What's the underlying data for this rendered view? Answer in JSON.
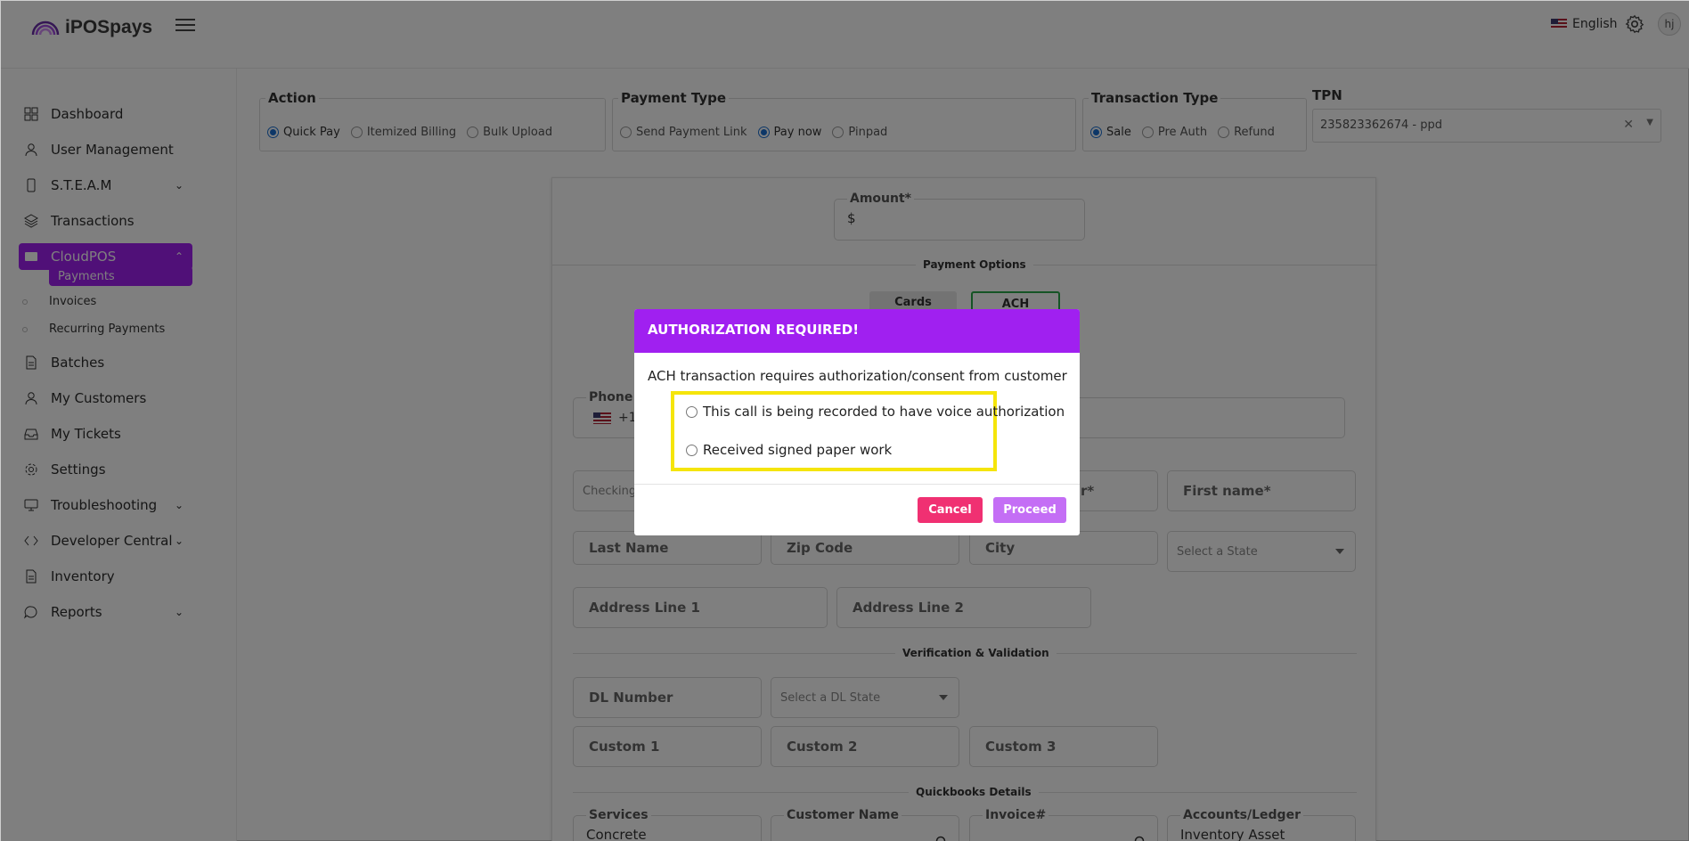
{
  "brand": {
    "name": "iPOSpays"
  },
  "header": {
    "language": "English",
    "user_initials": "hj"
  },
  "sidebar": {
    "items": [
      {
        "label": "Dashboard",
        "icon": "grid-icon"
      },
      {
        "label": "User Management",
        "icon": "user-icon"
      },
      {
        "label": "S.T.E.A.M",
        "icon": "mobile-icon"
      },
      {
        "label": "Transactions",
        "icon": "layers-icon"
      },
      {
        "label": "CloudPOS",
        "icon": "card-icon"
      },
      {
        "label": "Batches",
        "icon": "document-icon"
      },
      {
        "label": "My Customers",
        "icon": "user-icon"
      },
      {
        "label": "My Tickets",
        "icon": "inbox-icon"
      },
      {
        "label": "Settings",
        "icon": "gear-icon"
      },
      {
        "label": "Troubleshooting",
        "icon": "monitor-icon"
      },
      {
        "label": "Developer Central",
        "icon": "code-icon"
      },
      {
        "label": "Inventory",
        "icon": "document-icon"
      },
      {
        "label": "Reports",
        "icon": "chat-icon"
      }
    ],
    "cloudpos_sub": [
      "Payments",
      "Invoices",
      "Recurring Payments"
    ]
  },
  "filters": {
    "action": {
      "legend": "Action",
      "options": [
        "Quick Pay",
        "Itemized Billing",
        "Bulk Upload"
      ],
      "selected": "Quick Pay"
    },
    "payment_type": {
      "legend": "Payment Type",
      "options": [
        "Send Payment Link",
        "Pay now",
        "Pinpad"
      ],
      "selected": "Pay now"
    },
    "transaction_type": {
      "legend": "Transaction Type",
      "options": [
        "Sale",
        "Pre Auth",
        "Refund"
      ],
      "selected": "Sale"
    },
    "tpn": {
      "label": "TPN",
      "value": "235823362674 - ppd"
    }
  },
  "form": {
    "amount_label": "Amount*",
    "amount_prefix": "$",
    "payment_options_title": "Payment Options",
    "tab_cards": "Cards",
    "tab_ach": "ACH",
    "phone_label": "Phone",
    "phone_code": "+1",
    "checking_placeholder": "Checking",
    "first_name": "First name*",
    "last_name": "Last Name",
    "zip_code": "Zip Code",
    "city": "City",
    "state_placeholder": "Select a State",
    "address1": "Address Line 1",
    "address2": "Address Line 2",
    "verification_title": "Verification & Validation",
    "dl_number": "DL Number",
    "dl_state_placeholder": "Select a DL State",
    "custom1": "Custom 1",
    "custom2": "Custom 2",
    "custom3": "Custom 3",
    "quickbooks_title": "Quickbooks Details",
    "services_label": "Services",
    "services_value": "Concrete",
    "customer_name_label": "Customer Name",
    "invoice_label": "Invoice#",
    "accounts_label": "Accounts/Ledger",
    "accounts_value": "Inventory Asset",
    "partial_label": "r*"
  },
  "modal": {
    "title": "AUTHORIZATION REQUIRED!",
    "message": "ACH transaction requires authorization/consent from customer",
    "options": [
      "This call is being recorded to have voice authorization",
      "Received signed paper work"
    ],
    "cancel": "Cancel",
    "proceed": "Proceed"
  },
  "colors": {
    "brand_purple": "#a020f0",
    "cancel": "#f03072",
    "proceed": "#c46ef5",
    "highlight": "#f5e50a",
    "radio_selected": "#1a6fd1"
  }
}
